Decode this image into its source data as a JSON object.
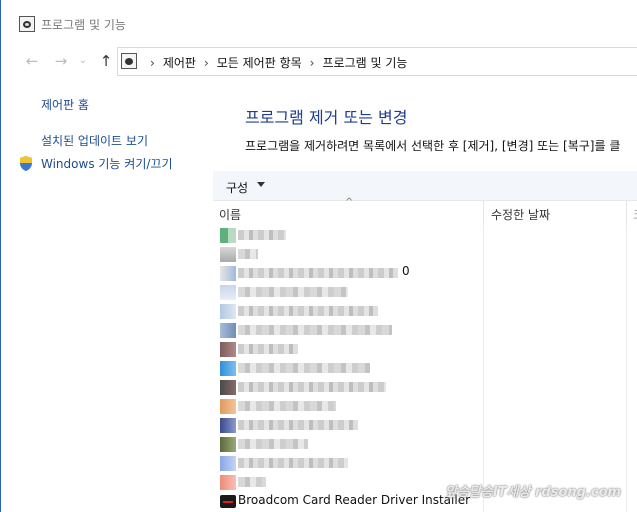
{
  "window": {
    "title": "프로그램 및 기능",
    "icon": "control-panel-icon"
  },
  "nav": {
    "back_icon": "←",
    "forward_icon": "→",
    "dropdown_icon": "⌄",
    "up_icon": "↑",
    "breadcrumbs": [
      "제어판",
      "모든 제어판 항목",
      "프로그램 및 기능"
    ],
    "separator": "›"
  },
  "sidebar": {
    "home_link": "제어판 홈",
    "updates_link": "설치된 업데이트 보기",
    "features_link": "Windows 기능 켜기/끄기"
  },
  "main": {
    "title": "프로그램 제거 또는 변경",
    "description": "프로그램을 제거하려면 목록에서 선택한 후 [제거], [변경] 또는 [복구]를 클"
  },
  "toolbar": {
    "organize_label": "구성"
  },
  "columns": {
    "name": "이름",
    "date": "수정한 날짜",
    "more": "크",
    "sort_icon": "^"
  },
  "programs": {
    "partial_suffix": "0",
    "last_program": "Broadcom Card Reader Driver Installer"
  },
  "watermark": "앞승달승IT세상 rdsong.com"
}
